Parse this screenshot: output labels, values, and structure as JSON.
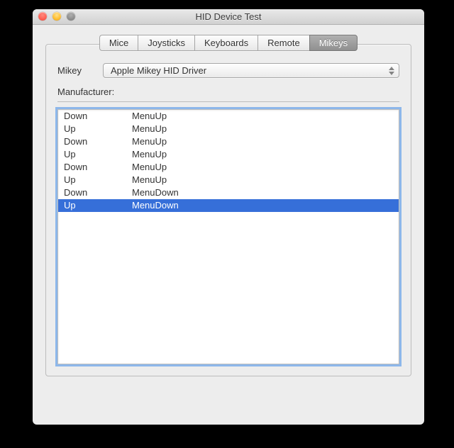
{
  "window": {
    "title": "HID Device Test"
  },
  "tabs": [
    {
      "label": "Mice",
      "selected": false
    },
    {
      "label": "Joysticks",
      "selected": false
    },
    {
      "label": "Keyboards",
      "selected": false
    },
    {
      "label": "Remote",
      "selected": false
    },
    {
      "label": "Mikeys",
      "selected": true
    }
  ],
  "mikey": {
    "label": "Mikey",
    "selected": "Apple Mikey HID Driver"
  },
  "manufacturer": {
    "label": "Manufacturer:",
    "value": ""
  },
  "events": [
    {
      "state": "Down",
      "code": "MenuUp",
      "selected": false
    },
    {
      "state": "Up",
      "code": "MenuUp",
      "selected": false
    },
    {
      "state": "Down",
      "code": "MenuUp",
      "selected": false
    },
    {
      "state": "Up",
      "code": "MenuUp",
      "selected": false
    },
    {
      "state": "Down",
      "code": "MenuUp",
      "selected": false
    },
    {
      "state": "Up",
      "code": "MenuUp",
      "selected": false
    },
    {
      "state": "Down",
      "code": "MenuDown",
      "selected": false
    },
    {
      "state": "Up",
      "code": "MenuDown",
      "selected": true
    }
  ]
}
